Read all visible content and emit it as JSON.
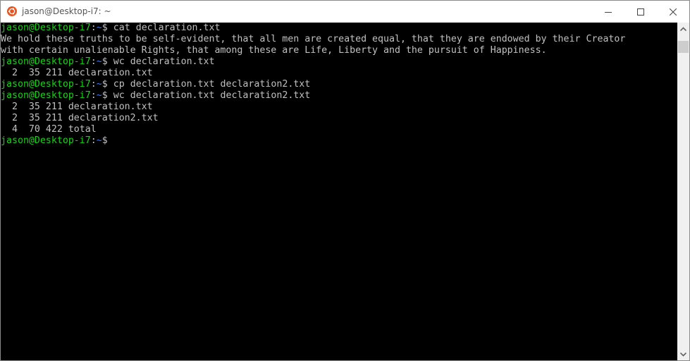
{
  "window": {
    "title": "jason@Desktop-i7: ~",
    "app_icon": "ubuntu-icon",
    "controls": [
      "minimize-icon",
      "maximize-icon",
      "close-icon"
    ]
  },
  "terminal": {
    "colors": {
      "background": "#000000",
      "text": "#c0c0c0",
      "user_host": "#13d313",
      "path": "#3b78ff"
    },
    "prompt": {
      "user_host": "jason@Desktop-i7",
      "colon": ":",
      "path": "~",
      "symbol": "$ "
    },
    "lines": [
      {
        "type": "prompt",
        "command": "cat declaration.txt"
      },
      {
        "type": "output",
        "text": "We hold these truths to be self-evident, that all men are created equal, that they are endowed by their Creator"
      },
      {
        "type": "output",
        "text": "with certain unalienable Rights, that among these are Life, Liberty and the pursuit of Happiness."
      },
      {
        "type": "prompt",
        "command": "wc declaration.txt"
      },
      {
        "type": "output",
        "text": "  2  35 211 declaration.txt"
      },
      {
        "type": "prompt",
        "command": "cp declaration.txt declaration2.txt"
      },
      {
        "type": "prompt",
        "command": "wc declaration.txt declaration2.txt"
      },
      {
        "type": "output",
        "text": "  2  35 211 declaration.txt"
      },
      {
        "type": "output",
        "text": "  2  35 211 declaration2.txt"
      },
      {
        "type": "output",
        "text": "  4  70 422 total"
      },
      {
        "type": "prompt",
        "command": ""
      }
    ]
  }
}
